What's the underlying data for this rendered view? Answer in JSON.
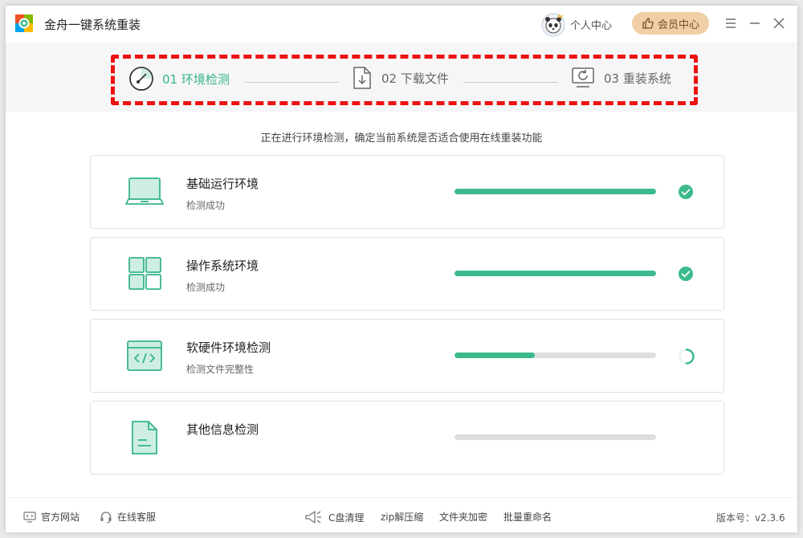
{
  "app": {
    "title": "金舟一键系统重装"
  },
  "header": {
    "personal_center": "个人中心",
    "vip_center": "会员中心"
  },
  "steps": [
    {
      "label": "01 环境检测",
      "active": true
    },
    {
      "label": "02 下载文件",
      "active": false
    },
    {
      "label": "03 重装系统",
      "active": false
    }
  ],
  "notice": "正在进行环境检测，确定当前系统是否适合使用在线重装功能",
  "checks": [
    {
      "title": "基础运行环境",
      "status": "检测成功",
      "progress": 1.0,
      "state": "done",
      "icon": "laptop-icon"
    },
    {
      "title": "操作系统环境",
      "status": "检测成功",
      "progress": 1.0,
      "state": "done",
      "icon": "grid-icon"
    },
    {
      "title": "软硬件环境检测",
      "status": "检测文件完整性",
      "progress": 0.4,
      "state": "loading",
      "icon": "code-window-icon"
    },
    {
      "title": "其他信息检测",
      "status": "",
      "progress": 0.0,
      "state": "pending",
      "icon": "document-icon"
    }
  ],
  "footer": {
    "website": "官方网站",
    "support": "在线客服",
    "c_clean": "C盘清理",
    "zip": "zip解压缩",
    "folder_encrypt": "文件夹加密",
    "batch_rename": "批量重命名",
    "version": "版本号：v2.3.6"
  },
  "colors": {
    "accent": "#36b58a",
    "progress": "#3cba8c",
    "highlight": "#ee1111",
    "vip": "#f0cfa6"
  }
}
